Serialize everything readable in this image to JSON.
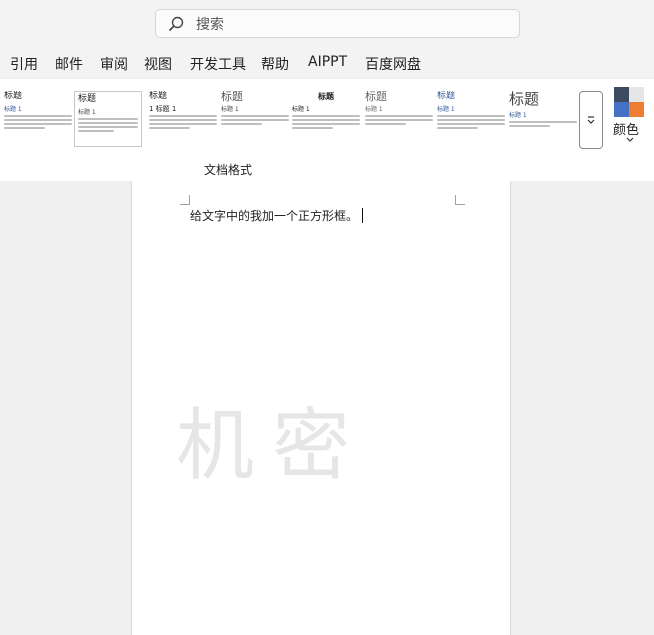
{
  "search": {
    "placeholder": "搜索"
  },
  "menu": [
    "引用",
    "邮件",
    "审阅",
    "视图",
    "开发工具",
    "帮助",
    "AIPPT",
    "百度网盘"
  ],
  "ribbon": {
    "styles": [
      {
        "title": "标题",
        "subtitle": "标题 1"
      },
      {
        "title": "标题",
        "subtitle": "标题 1"
      },
      {
        "title": "标题",
        "subtitle": "1  标题 1"
      },
      {
        "title": "标题",
        "subtitle": "标题 1"
      },
      {
        "title": "标题",
        "subtitle": "标题 1"
      },
      {
        "title": "标题",
        "subtitle": "标题 1"
      },
      {
        "title": "标题",
        "subtitle": "标题 1"
      },
      {
        "title": "标题",
        "subtitle": "标题 1"
      }
    ],
    "colors_label": "颜色",
    "group_label": "文档格式",
    "swatch_colors": [
      "#3c4b60",
      "#e7e6e6",
      "#4472c4",
      "#ed7d31"
    ]
  },
  "document": {
    "text": "给文字中的我加一个正方形框。",
    "watermark": "机密"
  }
}
